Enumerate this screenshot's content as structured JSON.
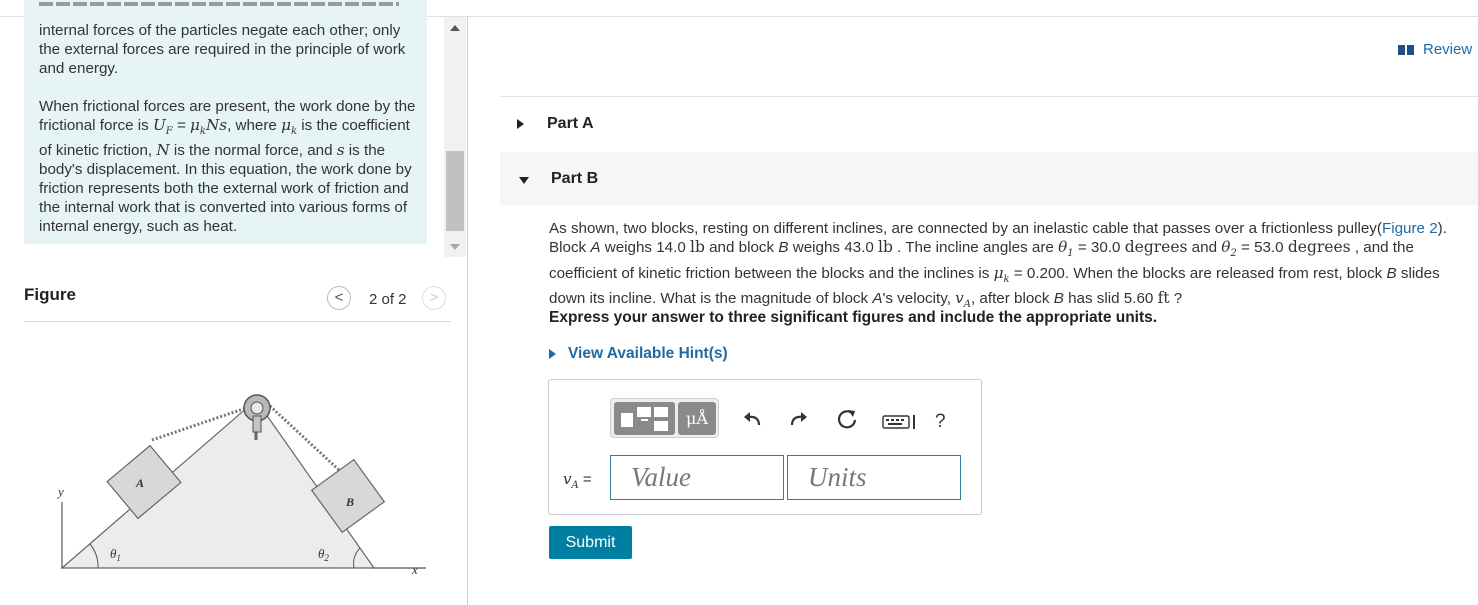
{
  "intro": {
    "p1": "internal forces of the particles negate each other; only the external forces are required in the principle of work and energy.",
    "p2_before_uf": "When frictional forces are present, the work done by the frictional force is ",
    "uf_symbol": "U",
    "uf_sub": "F",
    "uf_eq": " = ",
    "mu_symbol": "μ",
    "mu_sub": "k",
    "ns": "Ns",
    "p2_where": ", where ",
    "p2_is_coef": " is the coefficient of kinetic friction, ",
    "n_symbol": "N",
    "p2_normal": " is the normal force, and ",
    "s_symbol": "s",
    "p2_rest": " is the body's displacement. In this equation, the work done by friction represents both the external work of friction and the internal work that is converted into various forms of internal energy, such as heat."
  },
  "figure": {
    "title": "Figure",
    "pager_text": "2 of 2",
    "prev_glyph": "<",
    "next_glyph": ">",
    "labels": {
      "block_a": "A",
      "block_b": "B",
      "theta1": "θ",
      "theta1_sub": "1",
      "theta2": "θ",
      "theta2_sub": "2",
      "x_axis": "x",
      "y_axis": "y"
    }
  },
  "review": {
    "label": "Review"
  },
  "parts": [
    {
      "label": "Part A",
      "expanded": false
    },
    {
      "label": "Part B",
      "expanded": true
    }
  ],
  "problem": {
    "t1": "As shown, two blocks, resting on different inclines, are connected by an inelastic cable that passes over a frictionless pulley(",
    "figure_link": "Figure 2",
    "t2": "). Block ",
    "a": "A",
    "t3": " weighs 14.0 ",
    "lb": "lb",
    "t4": " and block ",
    "b": "B",
    "t5": " weighs 43.0 ",
    "t6": " . The incline angles are ",
    "theta": "θ",
    "sub1": "1",
    "sub2": "2",
    "t7": " = 30.0 ",
    "deg": "degrees",
    "t8": " and ",
    "t9": " = 53.0 ",
    "t10": " , and the coefficient of kinetic friction between the blocks and the inclines is ",
    "mu": "μ",
    "k": "k",
    "t11": " = 0.200. When the blocks are released from rest, block ",
    "t12": " slides down its incline. What is the magnitude of block ",
    "t13": "'s velocity, ",
    "v": "v",
    "t14": ", after block ",
    "t15": " has slid 5.60 ",
    "ft": "ft",
    "t16": " ?"
  },
  "instructions": "Express your answer to three significant figures and include the appropriate units.",
  "hints": {
    "label": "View Available Hint(s)"
  },
  "answer": {
    "var_symbol": "v",
    "var_sub": "A",
    "equals": "=",
    "value_placeholder": "Value",
    "units_placeholder": "Units",
    "unit_button": "μÅ",
    "help": "?"
  },
  "submit": {
    "label": "Submit"
  },
  "icons": {
    "templates": "templates-icon",
    "units": "units-icon",
    "undo": "undo-icon",
    "redo": "redo-icon",
    "reset": "reset-icon",
    "keyboard": "keyboard-icon",
    "help": "help-icon",
    "review": "book-icon"
  },
  "colors": {
    "accent": "#007fa3",
    "link": "#1f6aa5",
    "intro_bg": "#e6f4f6"
  }
}
